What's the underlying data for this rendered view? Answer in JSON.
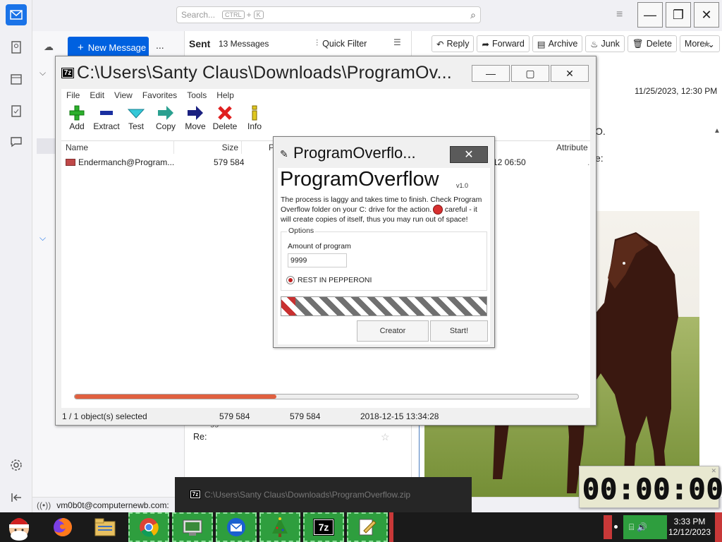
{
  "thunderbird": {
    "search_placeholder": "Search...",
    "search_kbd1": "CTRL",
    "search_plus": "+",
    "search_kbd2": "K",
    "new_message": "New Message",
    "more_dots": "...",
    "folder_label": "Sent",
    "message_count": "13 Messages",
    "quick_filter": "Quick Filter",
    "reply": "Reply",
    "forward": "Forward",
    "archive": "Archive",
    "junk": "Junk",
    "delete": "Delete",
    "more": "More",
    "date": "11/25/2023, 12:30 PM",
    "frag1": "O.",
    "frag2": "e:",
    "list_frag1": "eggiisied",
    "list_frag2": "Re:",
    "status_email": "vm0b0t@computernewb.com:"
  },
  "sevenzip": {
    "title": "C:\\Users\\Santy Claus\\Downloads\\ProgramOv...",
    "app_icon": "7z",
    "menu": [
      "File",
      "Edit",
      "View",
      "Favorites",
      "Tools",
      "Help"
    ],
    "tools": [
      {
        "label": "Add",
        "icon": "plus-icon",
        "color": "#2bb02b"
      },
      {
        "label": "Extract",
        "icon": "minus-icon",
        "color": "#1a2fa0"
      },
      {
        "label": "Test",
        "icon": "check-icon",
        "color": "#35b8c8"
      },
      {
        "label": "Copy",
        "icon": "arrow-icon",
        "color": "#2aa090"
      },
      {
        "label": "Move",
        "icon": "arrow-icon",
        "color": "#1a2080"
      },
      {
        "label": "Delete",
        "icon": "x-icon",
        "color": "#e02020"
      },
      {
        "label": "Info",
        "icon": "info-icon",
        "color": "#d8c020"
      }
    ],
    "columns": {
      "name": "Name",
      "size": "Size",
      "packed": "P",
      "attributes": "Attribute"
    },
    "row": {
      "name": "Endermanch@Program...",
      "size": "579 584",
      "modified": "12 06:50"
    },
    "status": {
      "selected": "1 / 1 object(s) selected",
      "size": "579 584",
      "packed": "579 584",
      "date": "2018-12-15 13:34:28"
    },
    "progress": 0.4
  },
  "dialog": {
    "title": "ProgramOverflo...",
    "heading": "ProgramOverflow",
    "version": "v1.0",
    "description": "The process is laggy and takes time to finish. Check Program Overflow folder on your C: drive for the action. Be careful - it will create copies of itself, thus you may run out of space!",
    "options_legend": "Options",
    "amount_label": "Amount of program",
    "amount_value": "9999",
    "radio_label": "REST IN PEPPERONI",
    "creator_button": "Creator",
    "start_button": "Start!"
  },
  "toast": {
    "text": "C:\\Users\\Santy Claus\\Downloads\\ProgramOverflow.zip"
  },
  "timer": {
    "display": "00:00:00"
  },
  "taskbar": {
    "time": "3:33 PM",
    "date": "12/12/2023"
  }
}
